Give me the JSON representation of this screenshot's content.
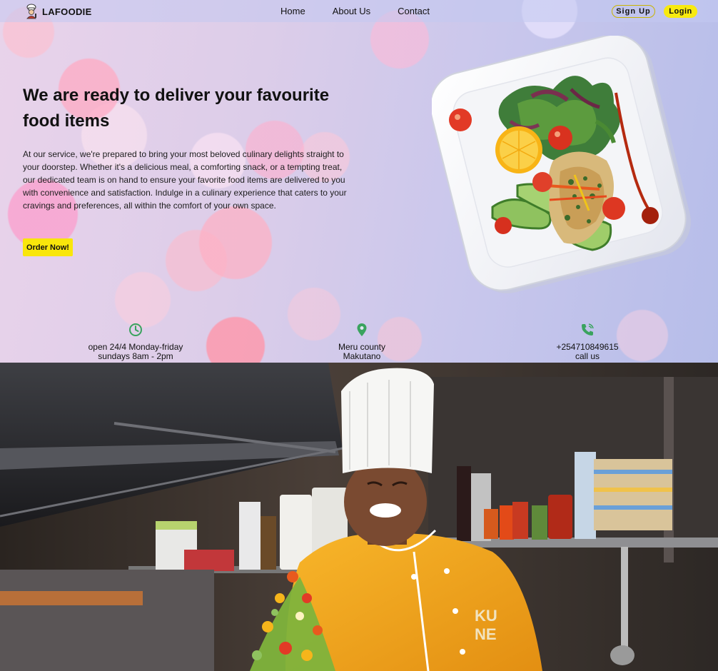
{
  "nav": {
    "brand": "LAFOODIE",
    "links": [
      "Home",
      "About Us",
      "Contact"
    ],
    "signup_label": "Sign Up",
    "login_label": "Login"
  },
  "hero": {
    "headline": "We are ready to deliver your favourite food items",
    "description": "At our service, we're prepared to bring your most beloved culinary delights straight to your doorstep. Whether it's a delicious meal, a comforting snack, or a tempting treat, our dedicated team is on hand to ensure your favorite food items are delivered to you with convenience and satisfaction. Indulge in a culinary experience that caters to your cravings and preferences, all within the comfort of your own space.",
    "cta_label": "Order Now!"
  },
  "info": {
    "hours": {
      "icon": "clock-icon",
      "line1": "open 24/4 Monday-friday",
      "line2": "sundays 8am - 2pm"
    },
    "location": {
      "icon": "location-pin-icon",
      "line1": "Meru county",
      "line2": "Makutano"
    },
    "phone": {
      "icon": "phone-icon",
      "line1": "+254710849615",
      "line2": "call us"
    }
  },
  "colors": {
    "accent_yellow": "#f8ea10",
    "icon_green": "#3aa35e",
    "chef_jacket": "#f4a81c"
  }
}
